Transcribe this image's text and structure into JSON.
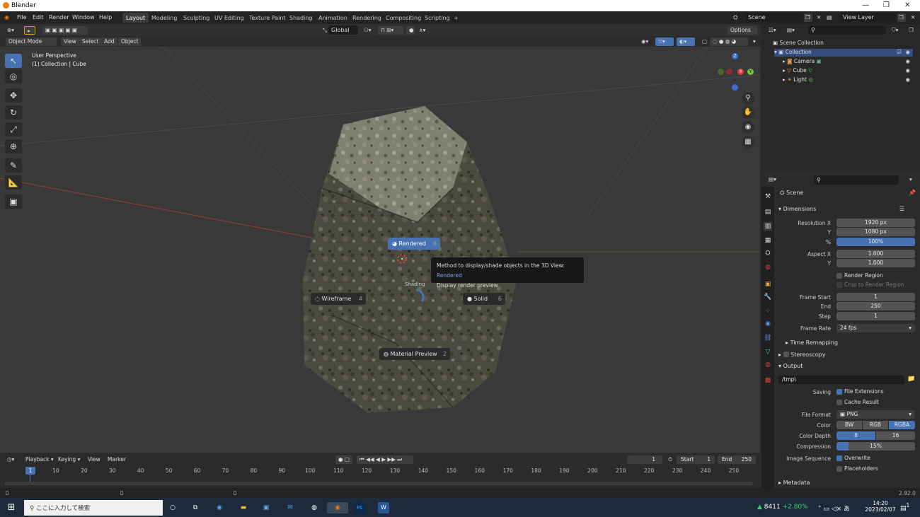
{
  "titlebar": {
    "title": "Blender",
    "min": "—",
    "max": "❐",
    "close": "✕"
  },
  "menu": [
    "File",
    "Edit",
    "Render",
    "Window",
    "Help"
  ],
  "workspaces": [
    "Layout",
    "Modeling",
    "Sculpting",
    "UV Editing",
    "Texture Paint",
    "Shading",
    "Animation",
    "Rendering",
    "Compositing",
    "Scripting"
  ],
  "workspace_add": "+",
  "scene": {
    "value": "Scene",
    "view_layer": "View Layer"
  },
  "header3d": {
    "transform": "Global",
    "options": "Options"
  },
  "header3d2": {
    "mode": "Object Mode",
    "view": "View",
    "select": "Select",
    "add": "Add",
    "object": "Object"
  },
  "viewport": {
    "perspective": "User Perspective",
    "collection": "(1) Collection | Cube"
  },
  "gizmo": {
    "z": "Z",
    "y": "Y",
    "x": "X"
  },
  "pie": {
    "rendered": "Rendered",
    "rendered_num": "8",
    "wireframe": "Wireframe",
    "wireframe_num": "4",
    "solid": "Solid",
    "solid_num": "6",
    "material": "Material Preview",
    "material_num": "2",
    "center": "Shading"
  },
  "tooltip": {
    "line1": "Method to display/shade objects in the 3D View:",
    "value": "Rendered",
    "line2": "Display render preview"
  },
  "outliner": {
    "root": "Scene Collection",
    "collection": "Collection",
    "items": [
      "Camera",
      "Cube",
      "Light"
    ]
  },
  "properties": {
    "scene": "Scene",
    "dimensions": "Dimensions",
    "res_x_label": "Resolution X",
    "res_x": "1920 px",
    "res_y_label": "Y",
    "res_y": "1080 px",
    "pct_label": "%",
    "pct": "100%",
    "aspect_x_label": "Aspect X",
    "aspect_x": "1.000",
    "aspect_y_label": "Y",
    "aspect_y": "1.000",
    "render_region": "Render Region",
    "crop": "Crop to Render Region",
    "frame_start_label": "Frame Start",
    "frame_start": "1",
    "end_label": "End",
    "end": "250",
    "step_label": "Step",
    "step": "1",
    "frame_rate_label": "Frame Rate",
    "frame_rate": "24 fps",
    "time_remap": "Time Remapping",
    "stereoscopy": "Stereoscopy",
    "output": "Output",
    "path": "/tmp\\",
    "saving_label": "Saving",
    "file_ext": "File Extensions",
    "cache": "Cache Result",
    "file_format_label": "File Format",
    "file_format": "PNG",
    "color_label": "Color",
    "bw": "BW",
    "rgb": "RGB",
    "rgba": "RGBA",
    "depth_label": "Color Depth",
    "depth8": "8",
    "depth16": "16",
    "compression_label": "Compression",
    "compression": "15%",
    "compression_value": 0.15,
    "image_seq_label": "Image Sequence",
    "overwrite": "Overwrite",
    "placeholders": "Placeholders",
    "metadata": "Metadata"
  },
  "timeline": {
    "playback": "Playback",
    "keying": "Keying",
    "view": "View",
    "marker": "Marker",
    "current": "1",
    "start_label": "Start",
    "start": "1",
    "end_label": "End",
    "end": "250",
    "ticks": [
      "1",
      "10",
      "20",
      "30",
      "40",
      "50",
      "60",
      "70",
      "80",
      "90",
      "100",
      "110",
      "120",
      "130",
      "140",
      "150",
      "160",
      "170",
      "180",
      "190",
      "200",
      "210",
      "220",
      "230",
      "240",
      "250"
    ]
  },
  "status": {
    "version": "2.92.0"
  },
  "taskbar": {
    "search": "ここに入力して検索",
    "stock": "8411",
    "change": "+2.80%",
    "time": "14:20",
    "date": "2023/02/07",
    "notif": "1"
  }
}
